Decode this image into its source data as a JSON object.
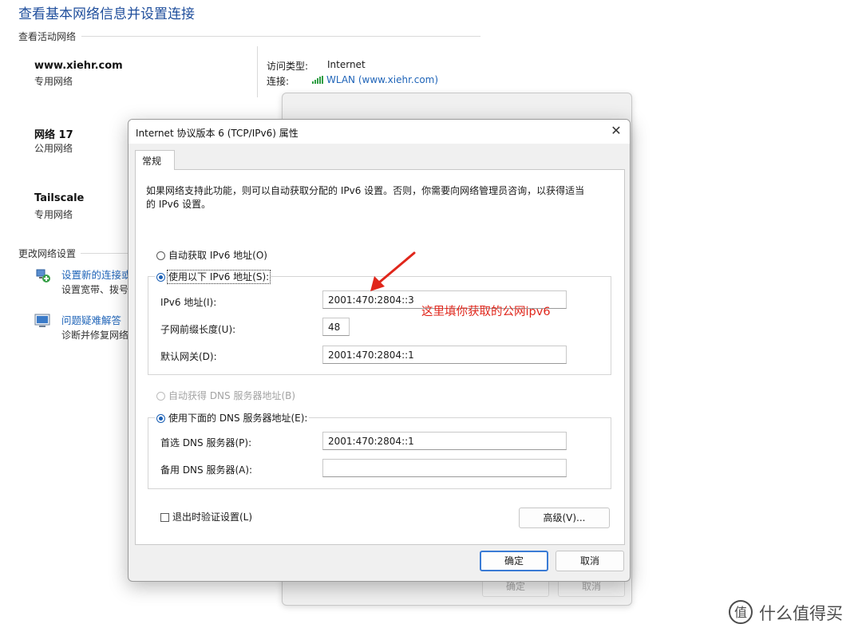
{
  "page": {
    "title": "查看基本网络信息并设置连接",
    "active_networks_header": "查看活动网络",
    "networks": [
      {
        "name": "www.xiehr.com",
        "type": "专用网络"
      },
      {
        "name": "网络 17",
        "type": "公用网络"
      },
      {
        "name": "Tailscale",
        "type": "专用网络"
      }
    ],
    "access_type_label": "访问类型:",
    "access_type_value": "Internet",
    "connection_label": "连接:",
    "connection_value": "WLAN (www.xiehr.com)",
    "change_settings_header": "更改网络设置",
    "tasks": [
      {
        "link": "设置新的连接或",
        "desc": "设置宽带、拨号"
      },
      {
        "link": "问题疑难解答",
        "desc": "诊断并修复网络"
      }
    ]
  },
  "ghost_dialog": {
    "ok_label": "确定",
    "cancel_label": "取消"
  },
  "dialog": {
    "title": "Internet 协议版本 6 (TCP/IPv6) 属性",
    "close_glyph": "✕",
    "tab_general": "常规",
    "description_line1": "如果网络支持此功能，则可以自动获取分配的 IPv6 设置。否则，你需要向网络管理员咨询，以获得适当",
    "description_line2": "的 IPv6 设置。",
    "radio_auto_ip": "自动获取 IPv6 地址(O)",
    "radio_manual_ip": "使用以下 IPv6 地址(S):",
    "ipv6_address_label": "IPv6 地址(I):",
    "ipv6_address_value": "2001:470:2804::3",
    "prefix_length_label": "子网前缀长度(U):",
    "prefix_length_value": "48",
    "gateway_label": "默认网关(D):",
    "gateway_value": "2001:470:2804::1",
    "radio_auto_dns": "自动获得 DNS 服务器地址(B)",
    "radio_manual_dns": "使用下面的 DNS 服务器地址(E):",
    "preferred_dns_label": "首选 DNS 服务器(P):",
    "preferred_dns_value": "2001:470:2804::1",
    "alternate_dns_label": "备用 DNS 服务器(A):",
    "alternate_dns_value": "",
    "validate_on_exit_label": "退出时验证设置(L)",
    "advanced_label": "高级(V)...",
    "ok_label": "确定",
    "cancel_label": "取消"
  },
  "annotation": {
    "text": "这里填你获取的公网ipv6",
    "color": "#e0261b"
  },
  "watermark": {
    "text": "什么值得买",
    "logo_glyph": "值"
  },
  "icons": {
    "wifi": "wifi-signal-icon",
    "new_connection": "network-setup-icon",
    "troubleshoot": "troubleshoot-icon",
    "arrow": "red-arrow-icon"
  }
}
